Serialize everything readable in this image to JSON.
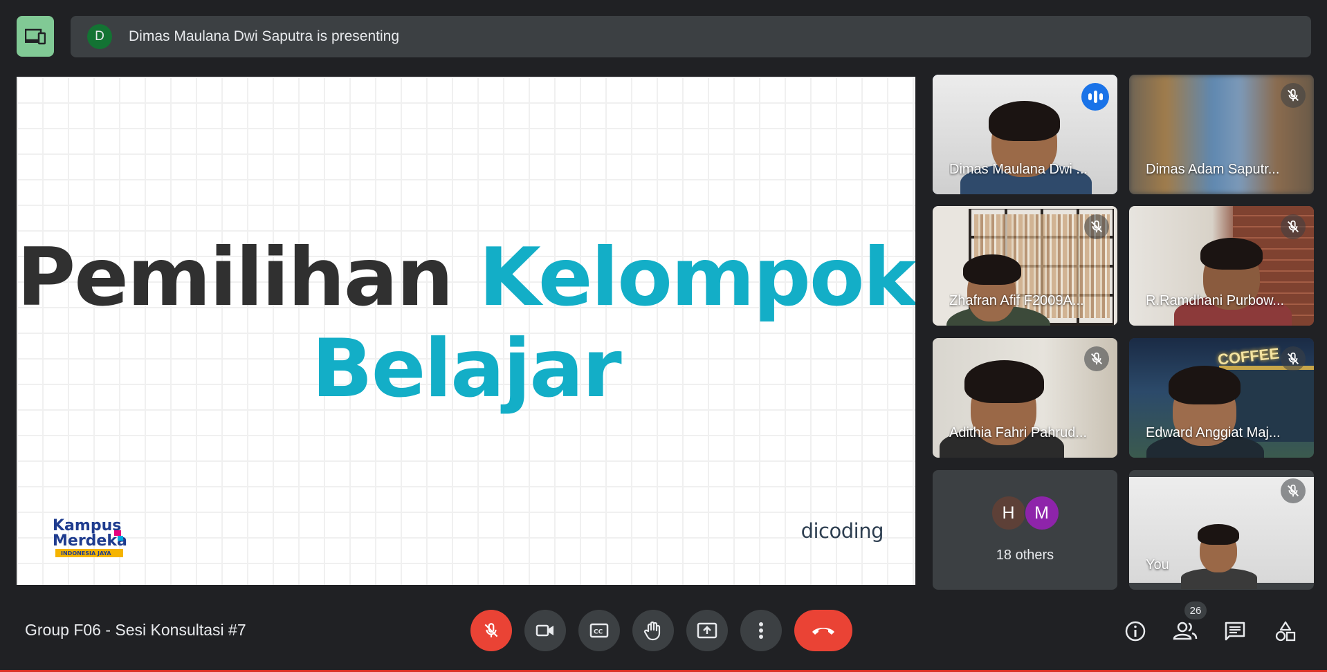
{
  "presenting_bar": {
    "avatar_letter": "D",
    "text": "Dimas Maulana Dwi Saputra is presenting"
  },
  "slide": {
    "title_word1": "Pemilihan",
    "title_word2": "Kelompok",
    "title_word3": "Belajar",
    "logo_left": "Kampus Merdeka",
    "logo_left_tagline": "INDONESIA JAYA",
    "logo_right": "dicoding"
  },
  "participants": [
    {
      "name": "Dimas Maulana Dwi ...",
      "state": "speaking"
    },
    {
      "name": "Dimas Adam Saputr...",
      "state": "muted"
    },
    {
      "name": "Zhafran Afif F2009A...",
      "state": "muted"
    },
    {
      "name": "R.Ramdhani Purbow...",
      "state": "muted"
    },
    {
      "name": "Adithia Fahri Pahrud...",
      "state": "muted"
    },
    {
      "name": "Edward Anggiat Maj...",
      "state": "muted"
    },
    {
      "name": "You",
      "state": "muted"
    }
  ],
  "others": {
    "avatar1": "H",
    "avatar2": "M",
    "label": "18 others"
  },
  "tile_text": {
    "coffee_sign": "COFFEE"
  },
  "meeting": {
    "title": "Group F06 - Sesi Konsultasi #7",
    "participant_count": "26"
  },
  "controls": [
    "mic-off",
    "camera",
    "captions",
    "raise-hand",
    "present",
    "more",
    "hang-up"
  ],
  "right_controls": [
    "info",
    "people",
    "chat",
    "activities"
  ],
  "colors": {
    "background": "#202124",
    "accent_teal": "#13aec7",
    "danger": "#ea4335",
    "speaking": "#1a73e8",
    "layout_button": "#81c995"
  }
}
